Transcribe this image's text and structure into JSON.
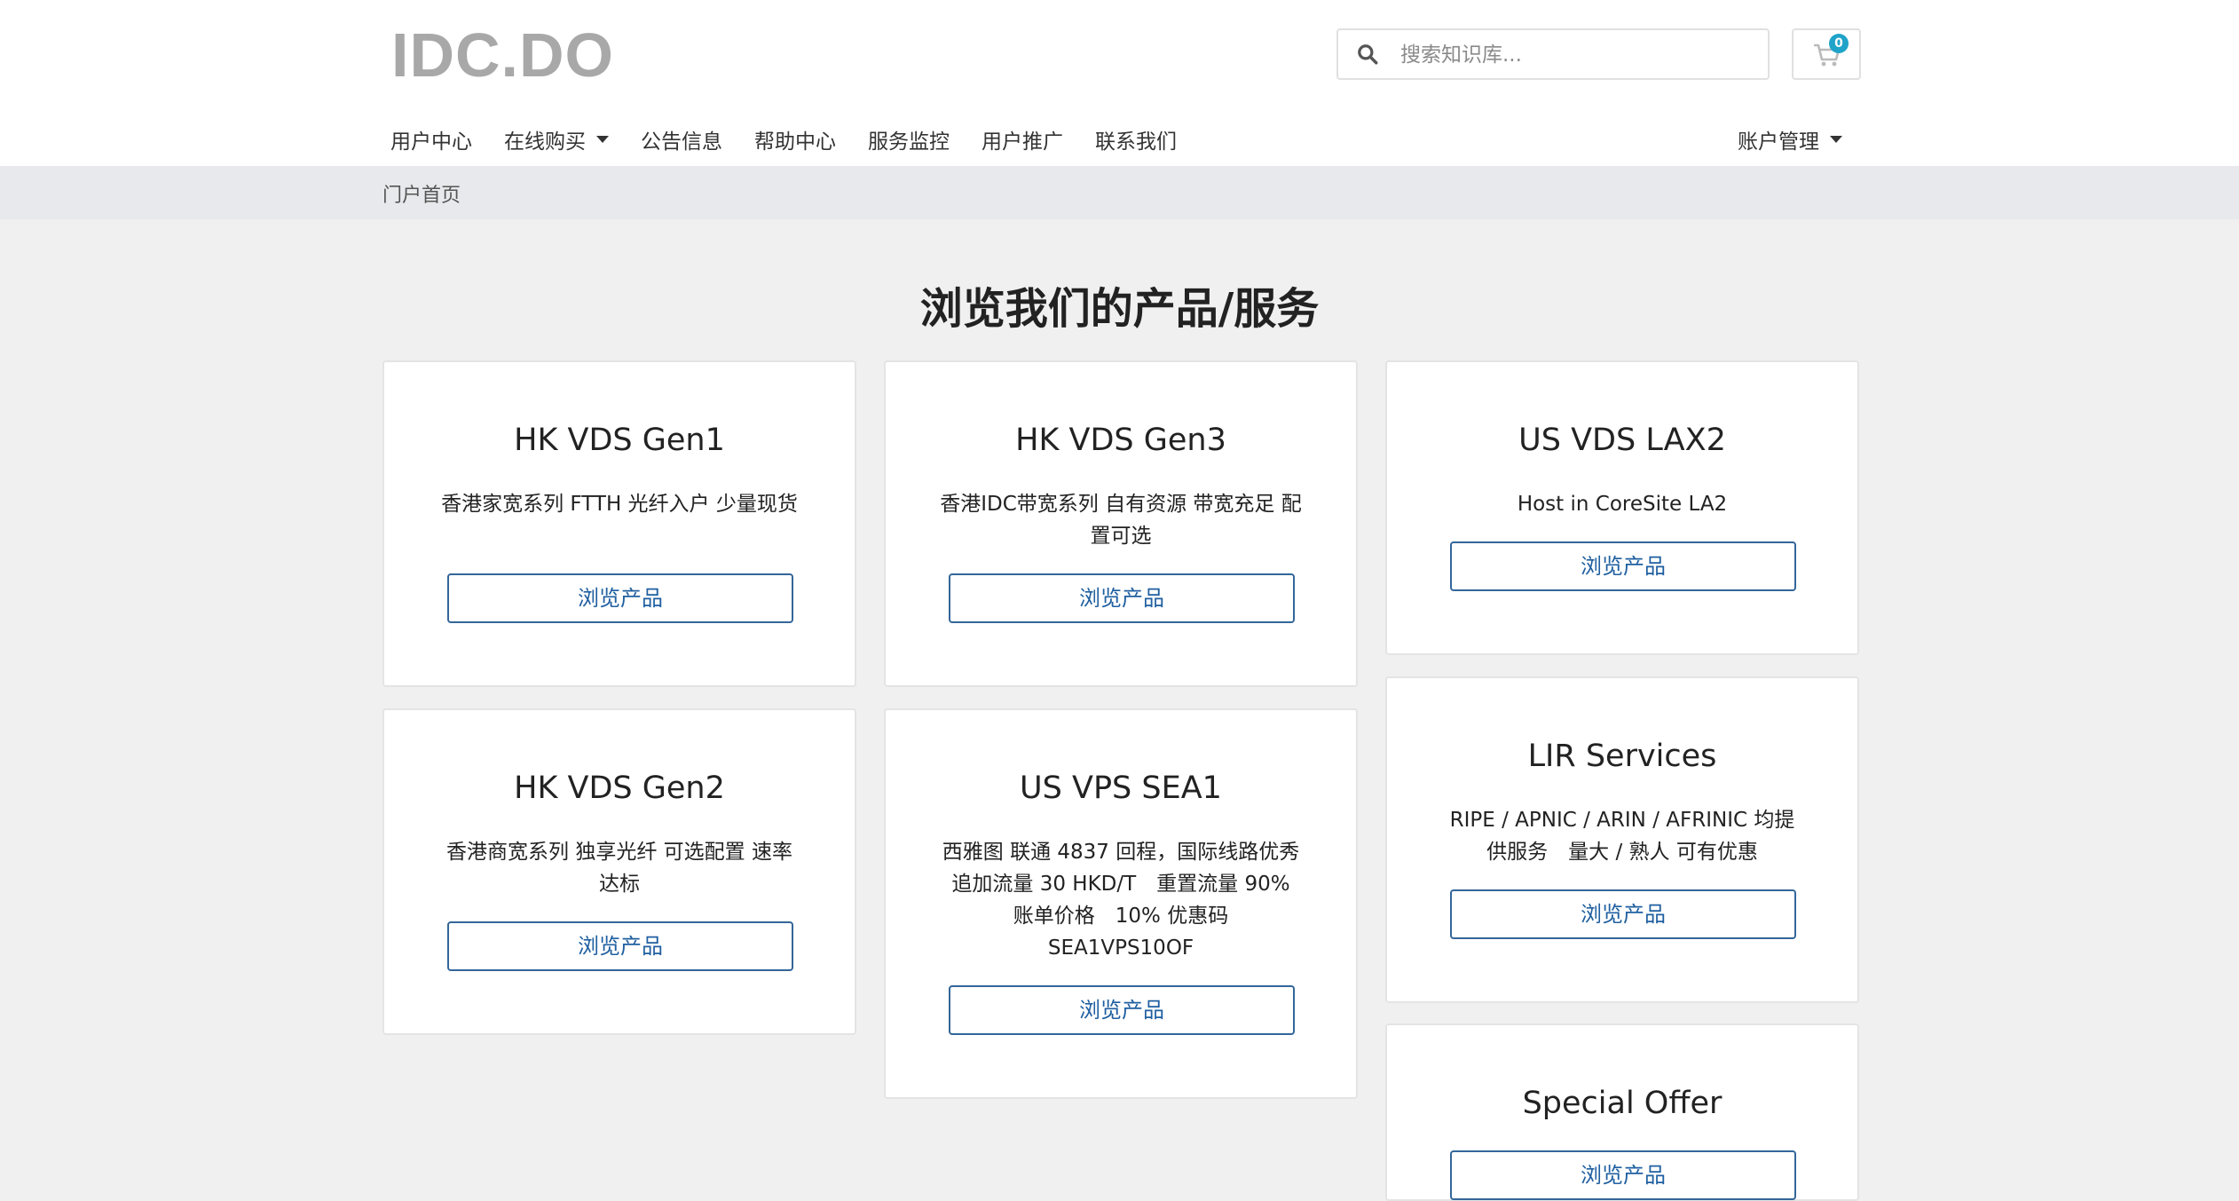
{
  "header": {
    "logo": "IDC.DO",
    "search_placeholder": "搜索知识库...",
    "cart_count": "0"
  },
  "nav": {
    "items": [
      {
        "label": "用户中心"
      },
      {
        "label": "在线购买",
        "dropdown": true
      },
      {
        "label": "公告信息"
      },
      {
        "label": "帮助中心"
      },
      {
        "label": "服务监控"
      },
      {
        "label": "用户推广"
      },
      {
        "label": "联系我们"
      }
    ],
    "account_label": "账户管理"
  },
  "breadcrumb": "门户首页",
  "page_title": "浏览我们的产品/服务",
  "products": [
    {
      "title": "HK VDS Gen1",
      "description": "香港家宽系列 FTTH 光纤入户 少量现货",
      "button": "浏览产品"
    },
    {
      "title": "HK VDS Gen3",
      "description": "香港IDC带宽系列 自有资源 带宽充足 配置可选",
      "button": "浏览产品"
    },
    {
      "title": "US VDS LAX2",
      "description": "Host in CoreSite LA2",
      "button": "浏览产品"
    },
    {
      "title": "HK VDS Gen2",
      "description": "香港商宽系列 独享光纤 可选配置 速率达标",
      "button": "浏览产品"
    },
    {
      "title": "US VPS SEA1",
      "description": "西雅图 联通 4837 回程，国际线路优秀　追加流量 30 HKD/T　重置流量 90% 账单价格　10% 优惠码 SEA1VPS10OF",
      "button": "浏览产品"
    },
    {
      "title": "LIR Services",
      "description": "RIPE / APNIC / ARIN / AFRINIC 均提供服务　量大 / 熟人 可有优惠",
      "button": "浏览产品"
    },
    {
      "title": "Special Offer",
      "description": "",
      "button": "浏览产品"
    }
  ],
  "colors": {
    "button_border": "#336699",
    "badge": "#1fa3c9",
    "logo": "#a8a8a8"
  }
}
